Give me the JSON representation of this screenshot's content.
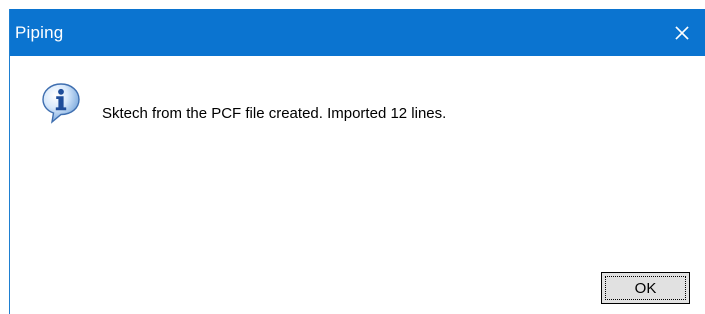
{
  "window": {
    "title": "Piping"
  },
  "dialog": {
    "message": "Sktech from the PCF file created. Imported 12 lines.",
    "icon": "info-icon",
    "ok_label": "OK"
  },
  "colors": {
    "titlebar": "#0b74d0",
    "button_face": "#e1e1e1"
  }
}
